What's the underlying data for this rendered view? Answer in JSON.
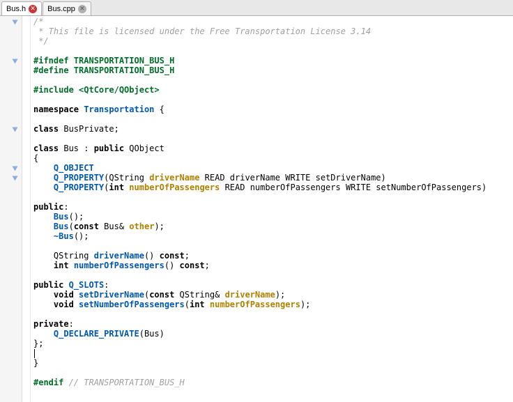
{
  "tabs": [
    {
      "label": "Bus.h",
      "active": true,
      "modified": true
    },
    {
      "label": "Bus.cpp",
      "active": false,
      "modified": false
    }
  ],
  "code": {
    "c_open": "/*",
    "c_body": " * This file is licensed under the Free Transportation License 3.14",
    "c_close": " */",
    "ifndef_kw": "#ifndef",
    "guard": " TRANSPORTATION_BUS_H",
    "define_kw": "#define",
    "include_kw": "#include",
    "include_path": " <QtCore/QObject>",
    "namespace_kw": "namespace",
    "ns_name": " Transportation ",
    "brace_open": "{",
    "brace_close": "}",
    "class_kw": "class",
    "privclass": " BusPrivate",
    "semicolon": ";",
    "bus": " Bus ",
    "colon": ": ",
    "public_kw": "public",
    "qobject": " QObject",
    "q_object": "Q_OBJECT",
    "q_property": "Q_PROPERTY",
    "lparen": "(",
    "rparen": ")",
    "qstring": "QString ",
    "drivername": "driverName",
    "read_drv": " READ driverName WRITE setDriverName",
    "int": "int ",
    "numpass": "numberOfPassengers",
    "read_np": " READ numberOfPassengers WRITE setNumberOfPassengers",
    "public_colon": ":",
    "bus_ctor": "Bus",
    "empty_parens": "()",
    "const_kw": "const",
    "busref": " Bus& ",
    "other": "other",
    "dtor": "~Bus",
    "const_suffix": " const",
    "q_slots": "Q_SLOTS",
    "void": "void ",
    "setdriver": "setDriverName",
    "qstringref": " QString& ",
    "setnum": "setNumberOfPassengers",
    "private_kw": "private",
    "q_decl_priv": "Q_DECLARE_PRIVATE",
    "bus_arg": "Bus",
    "brace_close_semi": "};",
    "endif_kw": "#endif",
    "endif_comment": " // TRANSPORTATION_BUS_H",
    "indent1": "    ",
    "indent2": "        "
  },
  "fold_lines": [
    1,
    5,
    12,
    16,
    17
  ]
}
